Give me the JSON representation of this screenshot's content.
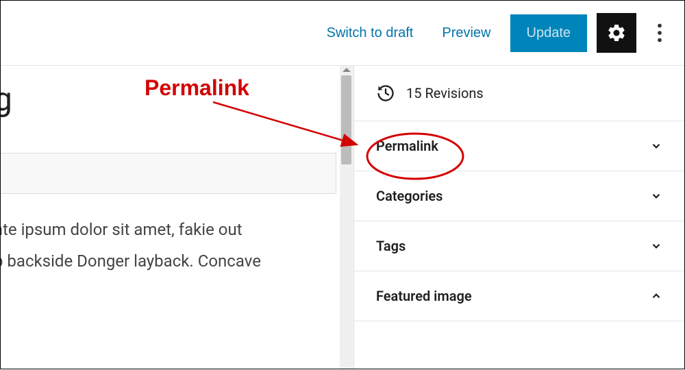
{
  "toolbar": {
    "switch_draft": "Switch to draft",
    "preview": "Preview",
    "update": "Update"
  },
  "editor": {
    "title_fragment": "g",
    "body_line1": "ate ipsum dolor sit amet, fakie out",
    "body_line2": "p backside Donger layback. Concave"
  },
  "sidebar": {
    "revisions": "15 Revisions",
    "panels": [
      {
        "label": "Permalink",
        "expanded": false
      },
      {
        "label": "Categories",
        "expanded": false
      },
      {
        "label": "Tags",
        "expanded": false
      },
      {
        "label": "Featured image",
        "expanded": true
      }
    ]
  },
  "annotation": {
    "label": "Permalink"
  }
}
